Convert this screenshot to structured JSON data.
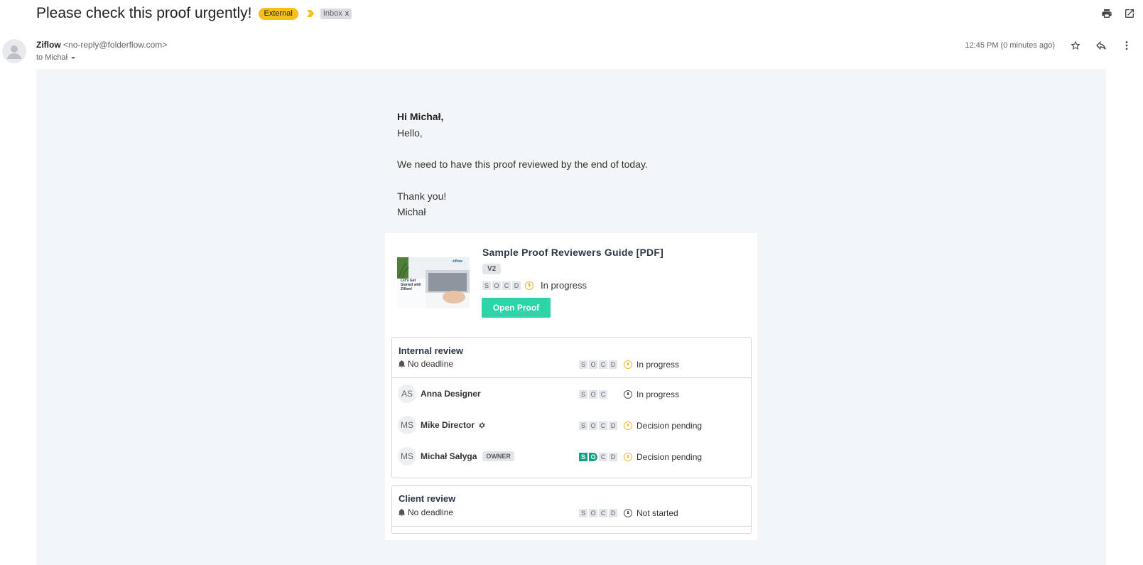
{
  "header": {
    "subject": "Please check this proof urgently!",
    "labels": {
      "external": "External",
      "inbox": "Inbox",
      "inbox_remove": "x"
    },
    "icons": [
      "print-icon",
      "open-in-new-window-icon"
    ]
  },
  "sender": {
    "name": "Ziflow",
    "email": "<no-reply@folderflow.com>",
    "to": "to Michał",
    "time": "12:45 PM (0 minutes ago)"
  },
  "message": {
    "greeting": "Hi Michał,",
    "line1": "Hello,",
    "line2": "We need to have this proof reviewed by the end of today.",
    "thanks": "Thank you!",
    "signature": "Michał"
  },
  "proof": {
    "title": "Sample Proof Reviewers Guide [PDF]",
    "version": "V2",
    "chips": [
      "S",
      "O",
      "C",
      "D"
    ],
    "status": "In progress",
    "open_button": "Open Proof",
    "thumb_text": "Let's Get Started with Ziflow!",
    "thumb_logo": "ziflow"
  },
  "stages": [
    {
      "title": "Internal review",
      "deadline": "No deadline",
      "chips": [
        "S",
        "O",
        "C",
        "D"
      ],
      "status": "In progress",
      "members": [
        {
          "initials": "AS",
          "name": "Anna Designer",
          "chips": [
            "S",
            "O",
            "C"
          ],
          "status": "In progress",
          "status_color": "grey"
        },
        {
          "initials": "MS",
          "name": "Mike Director",
          "chips": [
            "S",
            "O",
            "C",
            "D"
          ],
          "status": "Decision pending",
          "status_color": "orange"
        },
        {
          "initials": "MS",
          "name": "Michał Sałyga",
          "badge": "OWNER",
          "chips": [
            "S",
            "O",
            "C",
            "D"
          ],
          "status": "Decision pending",
          "status_color": "orange"
        }
      ]
    },
    {
      "title": "Client review",
      "deadline": "No deadline",
      "chips": [
        "S",
        "O",
        "C",
        "D"
      ],
      "status": "Not started"
    }
  ],
  "colors": {
    "accent_button": "#2dd4a7",
    "external_label": "#f7bf19",
    "status_orange": "#f5b82e",
    "chip_green": "#16a085"
  }
}
